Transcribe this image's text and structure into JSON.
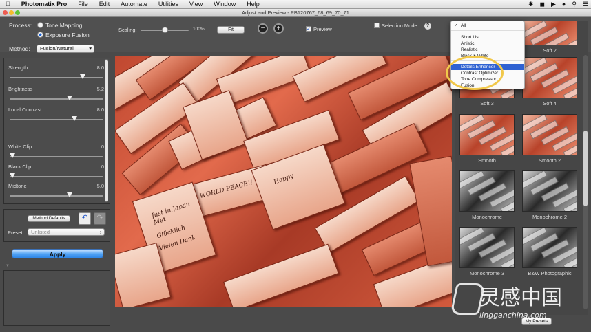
{
  "menubar": {
    "app": "Photomatix Pro",
    "items": [
      "File",
      "Edit",
      "Automate",
      "Utilities",
      "View",
      "Window",
      "Help"
    ]
  },
  "window": {
    "title": "Adjust and Preview - PB120767_68_69_70_71"
  },
  "toolbar": {
    "process_label": "Process:",
    "process_options": [
      "Tone Mapping",
      "Exposure Fusion"
    ],
    "process_selected": "Exposure Fusion",
    "method_label": "Method:",
    "method_value": "Fusion/Natural",
    "scaling_label": "Scaling:",
    "scaling_value": "100%",
    "scaling_fraction": 0.5,
    "fit_label": "Fit",
    "preview_label": "Preview",
    "preview_checked": true,
    "selection_mode_label": "Selection Mode",
    "selection_mode_checked": false,
    "help_label": "?"
  },
  "sliders": [
    {
      "label": "Strength",
      "value": "8.0",
      "fraction": 0.8
    },
    {
      "label": "Brightness",
      "value": "5.2",
      "fraction": 0.65
    },
    {
      "label": "Local Contrast",
      "value": "8.0",
      "fraction": 0.7
    },
    {
      "label": "White Clip",
      "value": "0",
      "fraction": 0.0
    },
    {
      "label": "Black Clip",
      "value": "0",
      "fraction": 0.0
    },
    {
      "label": "Midtone",
      "value": "5.0",
      "fraction": 0.65
    }
  ],
  "defaults": {
    "method_defaults_label": "Method Defaults",
    "preset_label": "Preset:",
    "preset_value": "Unlisted"
  },
  "apply_label": "Apply",
  "preview_image": {
    "writings": [
      "WORLD PEACE!!",
      "Just in Japan",
      "Met",
      "Glücklich",
      "Vielen Dank",
      "Happy"
    ]
  },
  "dropdown": {
    "checked_item": "All",
    "items": [
      "All",
      "Short List",
      "Artistic",
      "Realistic",
      "Black & White",
      "Details Enhancer",
      "Contrast Optimizer",
      "Tone Compressor",
      "Fusion"
    ],
    "selected": "Details Enhancer"
  },
  "thumbnails": [
    {
      "caption": "Soft 2",
      "style": "color"
    },
    {
      "caption": "Soft 3",
      "style": "color"
    },
    {
      "caption": "Soft 4",
      "style": "color"
    },
    {
      "caption": "Smooth",
      "style": "color"
    },
    {
      "caption": "Smooth 2",
      "style": "color"
    },
    {
      "caption": "Monochrome",
      "style": "mono"
    },
    {
      "caption": "Monochrome 2",
      "style": "mono"
    },
    {
      "caption": "Monochrome 3",
      "style": "mono"
    },
    {
      "caption": "B&W Photographic",
      "style": "mono"
    }
  ],
  "my_presets_label": "My Presets",
  "watermark": {
    "brand": "灵感中国",
    "url": "lingganchina.com"
  }
}
